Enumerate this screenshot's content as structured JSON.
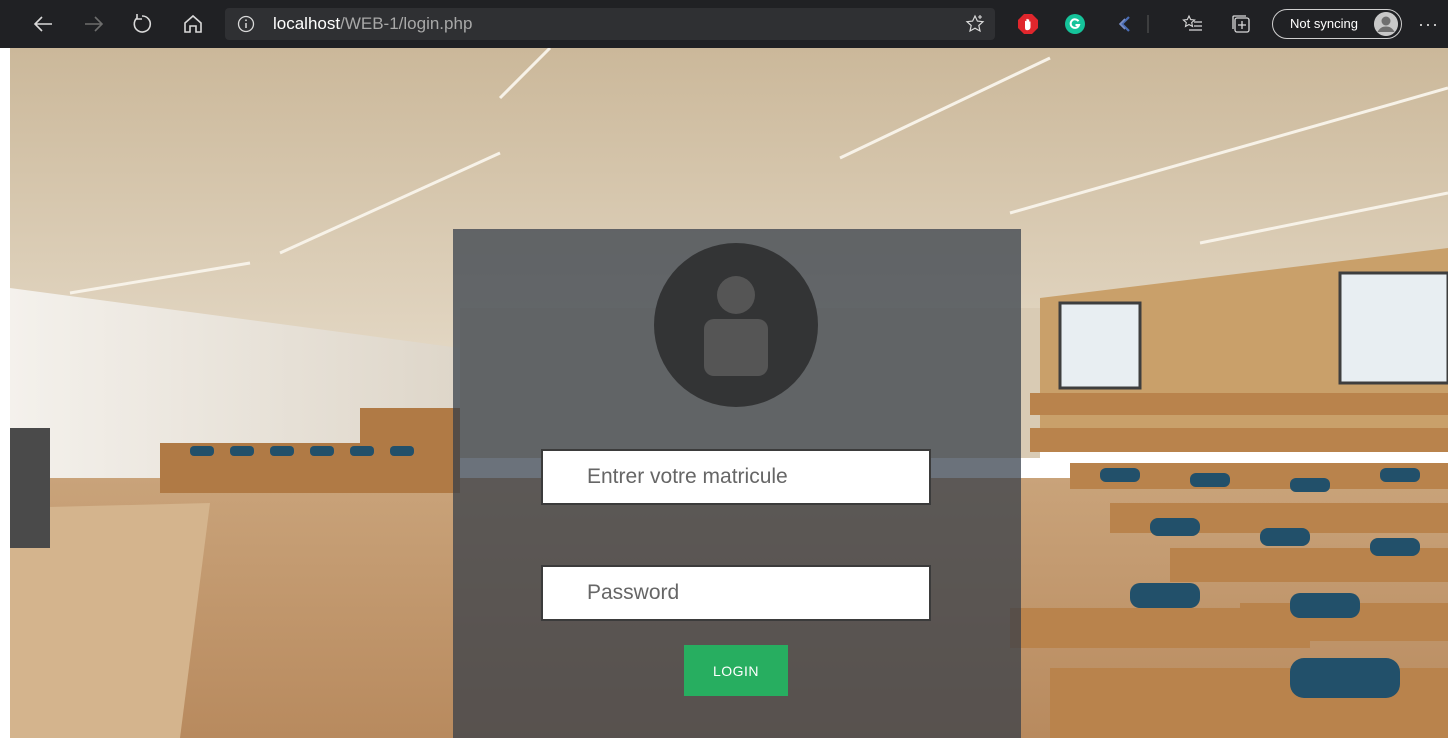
{
  "browser": {
    "url_host": "localhost",
    "url_path": "/WEB-1/login.php",
    "sync_label": "Not syncing",
    "more_label": "···",
    "icons": [
      "back-icon",
      "forward-icon",
      "refresh-icon",
      "home-icon",
      "info-icon",
      "star-icon",
      "adblock-icon",
      "grammarly-icon",
      "extension-icon",
      "favorites-icon",
      "collections-icon",
      "profile-icon",
      "more-icon"
    ]
  },
  "login": {
    "matricule_placeholder": "Entrer votre matricule",
    "password_placeholder": "Password",
    "login_label": "LOGIN"
  },
  "colors": {
    "login_button": "#27ae60",
    "panel_overlay": "#323c48",
    "avatar": "#333435"
  }
}
